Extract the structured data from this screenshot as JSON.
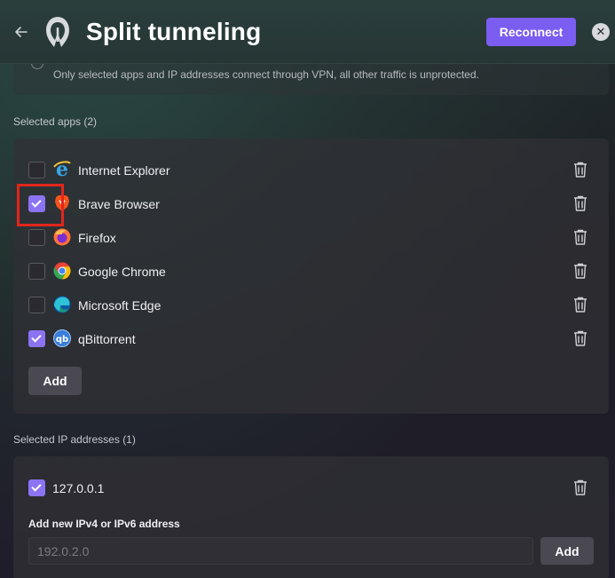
{
  "header": {
    "back_icon": "arrow-left-icon",
    "logo_icon": "vpn-shield-logo-icon",
    "title": "Split tunneling",
    "reconnect_label": "Reconnect",
    "close_icon": "close-circle-icon"
  },
  "mode": {
    "description": "Only selected apps and IP addresses connect through VPN, all other traffic is unprotected.",
    "selected": false
  },
  "apps_section": {
    "label": "Selected apps (2)",
    "items": [
      {
        "label": "Internet Explorer",
        "checked": false,
        "icon": "internet-explorer-icon"
      },
      {
        "label": "Brave Browser",
        "checked": true,
        "icon": "brave-browser-icon"
      },
      {
        "label": "Firefox",
        "checked": false,
        "icon": "firefox-icon"
      },
      {
        "label": "Google Chrome",
        "checked": false,
        "icon": "google-chrome-icon"
      },
      {
        "label": "Microsoft Edge",
        "checked": false,
        "icon": "microsoft-edge-icon"
      },
      {
        "label": "qBittorrent",
        "checked": true,
        "icon": "qbittorrent-icon"
      }
    ],
    "add_label": "Add",
    "delete_icon": "trash-icon"
  },
  "ip_section": {
    "label": "Selected IP addresses (1)",
    "items": [
      {
        "label": "127.0.0.1",
        "checked": true
      }
    ],
    "add_field_label": "Add new IPv4 or IPv6 address",
    "input_placeholder": "192.0.2.0",
    "add_label": "Add"
  },
  "colors": {
    "accent": "#7b5df1",
    "checkbox_checked": "#8c73f3",
    "highlight": "#e1261c"
  }
}
